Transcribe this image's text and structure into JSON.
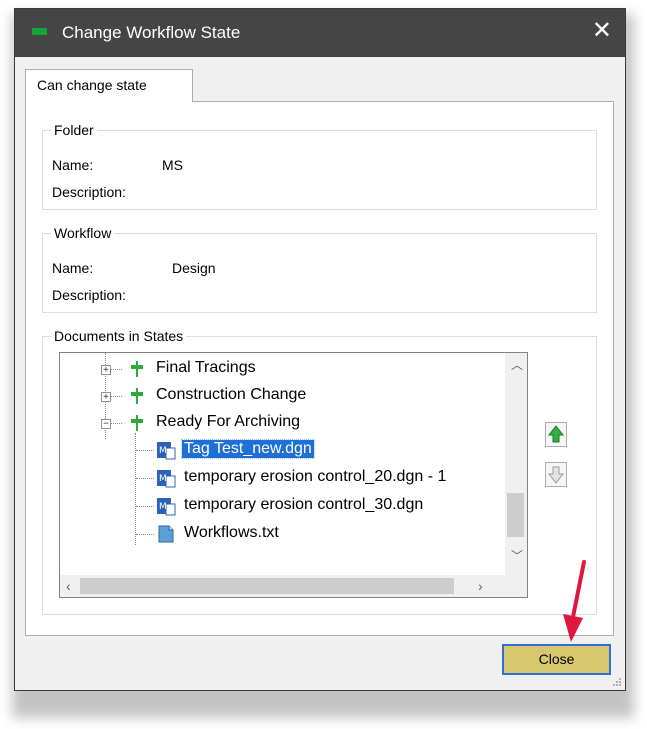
{
  "dialog": {
    "title": "Change Workflow State",
    "tab_label": "Can change state"
  },
  "folder": {
    "legend": "Folder",
    "name_label": "Name:",
    "name_value": "MS",
    "description_label": "Description:",
    "description_value": ""
  },
  "workflow": {
    "legend": "Workflow",
    "name_label": "Name:",
    "name_value": "Design",
    "description_label": "Description:",
    "description_value": ""
  },
  "documents": {
    "legend": "Documents in States",
    "states": [
      {
        "label": "Final Tracings",
        "expanded": false
      },
      {
        "label": "Construction Change",
        "expanded": false
      },
      {
        "label": "Ready For Archiving",
        "expanded": true
      }
    ],
    "files": [
      {
        "label": "Tag Test_new.dgn",
        "selected": true
      },
      {
        "label": "temporary erosion control_20.dgn - 1",
        "selected": false
      },
      {
        "label": "temporary erosion control_30.dgn",
        "selected": false
      },
      {
        "label": "Workflows.txt",
        "selected": false
      }
    ]
  },
  "buttons": {
    "close_label": "Close"
  },
  "colors": {
    "titlebar": "#454545",
    "selection": "#1e6fd6",
    "close_button": "#d7c86f",
    "annotation_arrow": "#e0163e",
    "state_icon": "#2faa3a"
  }
}
